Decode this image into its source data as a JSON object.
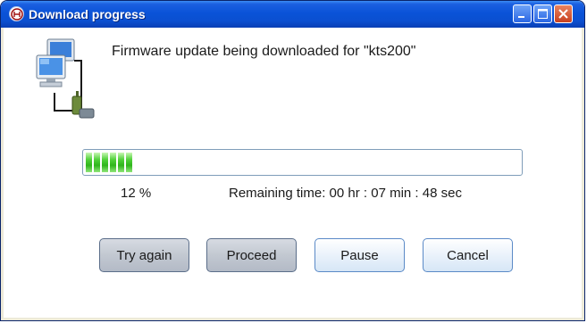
{
  "window": {
    "title": "Download progress",
    "controls": {
      "minimize": "minimize",
      "maximize": "maximize",
      "close": "close"
    }
  },
  "message": "Firmware update being downloaded for \"kts200\"",
  "progress": {
    "percent_value": 12,
    "percent_label": "12 %",
    "remaining": "Remaining time: 00 hr : 07 min : 48 sec"
  },
  "buttons": {
    "try_again": "Try again",
    "proceed": "Proceed",
    "pause": "Pause",
    "cancel": "Cancel"
  },
  "colors": {
    "titlebar": "#0a53d8",
    "progress_fill": "#2fb51c",
    "close": "#c8401f"
  },
  "icons": {
    "app": "bosch-logo-icon",
    "network": "network-computers-icon"
  }
}
